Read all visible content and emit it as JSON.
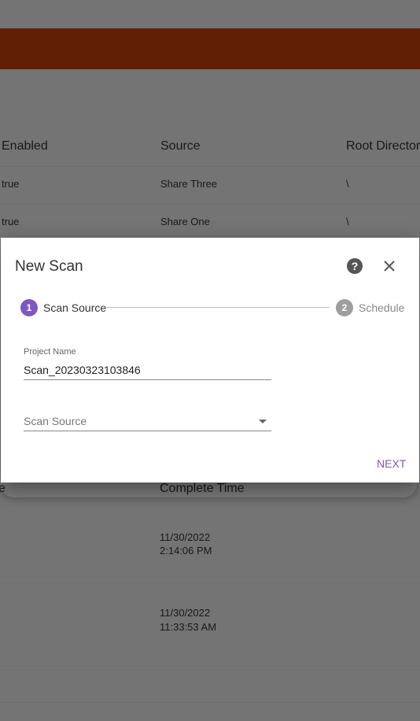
{
  "background_table": {
    "headers": [
      "Enabled",
      "Source",
      "Root Director"
    ],
    "rows": [
      {
        "enabled": "true",
        "source": "Share Three",
        "root": "\\"
      },
      {
        "enabled": "true",
        "source": "Share One",
        "root": "\\"
      }
    ]
  },
  "lower_table": {
    "header_left": "e",
    "header": "Complete Time",
    "rows": [
      {
        "date": "11/30/2022",
        "time": "2:14:06 PM"
      },
      {
        "date": "11/30/2022",
        "time": "11:33:53 AM"
      }
    ]
  },
  "dialog": {
    "title": "New Scan",
    "steps": [
      {
        "number": "1",
        "label": "Scan Source",
        "active": true
      },
      {
        "number": "2",
        "label": "Schedule",
        "active": false
      }
    ],
    "project_name": {
      "label": "Project Name",
      "value": "Scan_20230323103846"
    },
    "scan_source": {
      "placeholder": "Scan Source"
    },
    "next_label": "NEXT"
  },
  "colors": {
    "topbar": "#c2410c",
    "accent": "#7e57c2",
    "inactive_step": "#9e9e9e"
  },
  "icons": [
    "help-icon",
    "close-icon",
    "dropdown-caret-icon"
  ]
}
